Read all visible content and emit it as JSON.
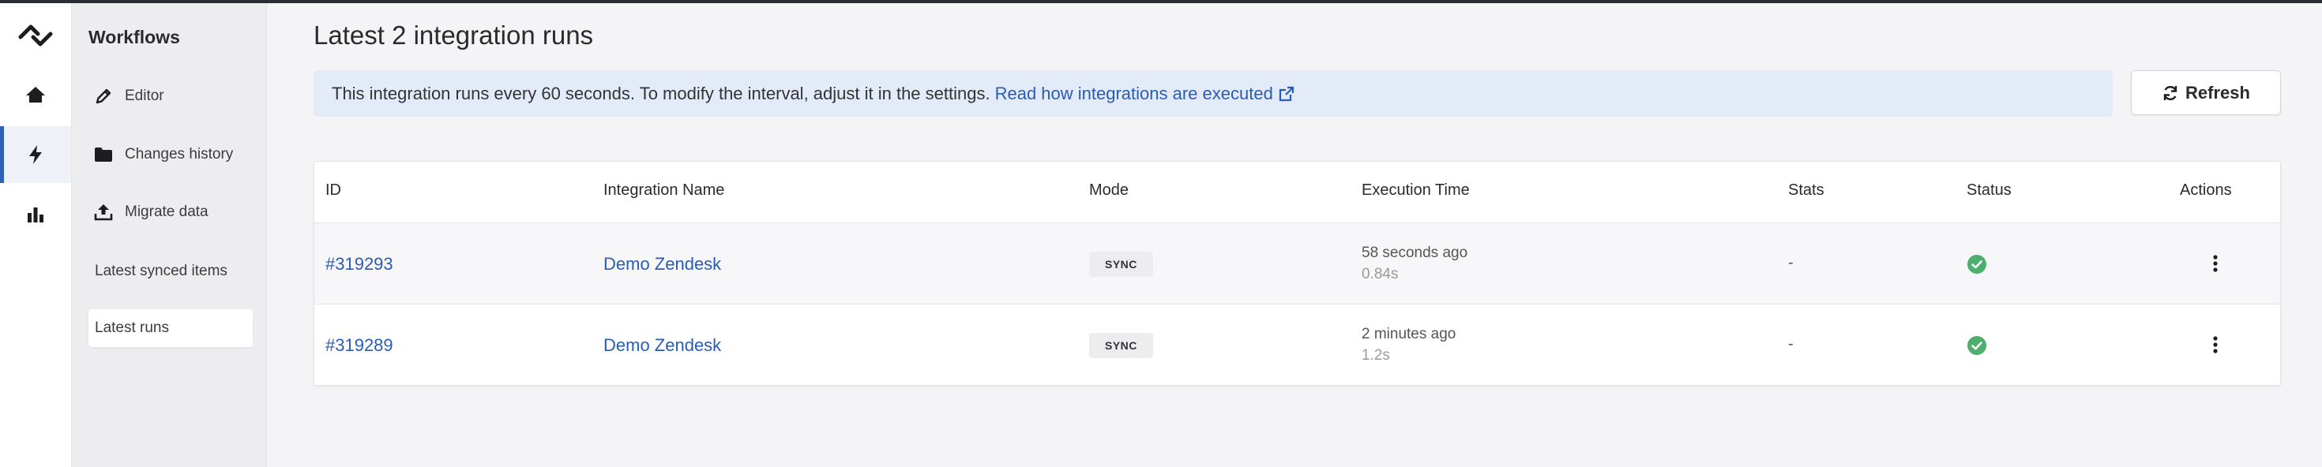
{
  "sidebar": {
    "title": "Workflows",
    "items": [
      {
        "label": "Editor",
        "icon": "pencil-icon"
      },
      {
        "label": "Changes history",
        "icon": "folder-icon"
      },
      {
        "label": "Migrate data",
        "icon": "upload-icon"
      },
      {
        "label": "Latest synced items"
      },
      {
        "label": "Latest runs",
        "active": true
      }
    ]
  },
  "rail": {
    "icons": [
      "logo-icon",
      "home-icon",
      "lightning-icon",
      "bar-chart-icon"
    ],
    "active": "lightning-icon"
  },
  "page": {
    "title": "Latest 2 integration runs"
  },
  "info": {
    "text": "This integration runs every 60 seconds. To modify the interval, adjust it in the settings.",
    "link": "Read how integrations are executed",
    "link_icon": "external-link-icon"
  },
  "refresh": {
    "label": "Refresh",
    "icon": "refresh-icon"
  },
  "table": {
    "columns": [
      "ID",
      "Integration Name",
      "Mode",
      "Execution Time",
      "Stats",
      "Status",
      "Actions"
    ],
    "rows": [
      {
        "id": "#319293",
        "name": "Demo Zendesk",
        "mode": "SYNC",
        "exec": "58 seconds ago",
        "duration": "0.84s",
        "stats": "-",
        "status": "success"
      },
      {
        "id": "#319289",
        "name": "Demo Zendesk",
        "mode": "SYNC",
        "exec": "2 minutes ago",
        "duration": "1.2s",
        "stats": "-",
        "status": "success"
      }
    ]
  },
  "colors": {
    "accent": "#2f5fbd",
    "link": "#2a5cb3",
    "info_bg": "#e3ebf9",
    "success": "#4caf6e"
  }
}
